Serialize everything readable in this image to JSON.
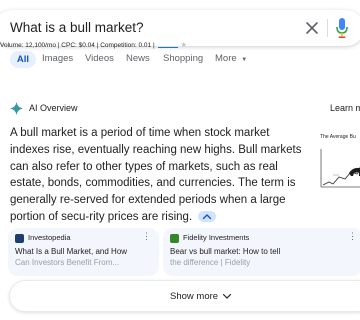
{
  "search": {
    "query": "What is a bull market?"
  },
  "seo_bar": {
    "text": "Volume: 12,100/mo | CPC: $0.04 | Competition: 0.01 |"
  },
  "tabs": [
    {
      "label": "All",
      "active": true
    },
    {
      "label": "Images"
    },
    {
      "label": "Videos"
    },
    {
      "label": "News"
    },
    {
      "label": "Shopping"
    },
    {
      "label": "More"
    }
  ],
  "ai_overview": {
    "title": "AI Overview",
    "learn_more": "Learn m",
    "paragraph": "A bull market is a period of time when stock market indexes rise, eventually reaching new highs. Bull markets can also refer to other types of markets, such as real estate, bonds, commodities, and currencies. The term is generally re-served for extended periods when a large portion of secu-rity prices are rising.",
    "chart_thumb_title": "The Average Bu"
  },
  "sources": [
    {
      "site": "Investopedia",
      "title": "What Is a Bull Market, and How",
      "title_line2": "Can Investors Benefit From...",
      "favicon_color": "#1c3d6e"
    },
    {
      "site": "Fidelity Investments",
      "title": "Bear vs bull market: How to tell",
      "title_line2": "the difference | Fidelity",
      "favicon_color": "#368727"
    }
  ],
  "show_more": {
    "label": "Show more"
  },
  "colors": {
    "accent": "#0b57d0",
    "tab_active_bg": "#e8f0fe",
    "card_bg": "#f3f6fc"
  }
}
